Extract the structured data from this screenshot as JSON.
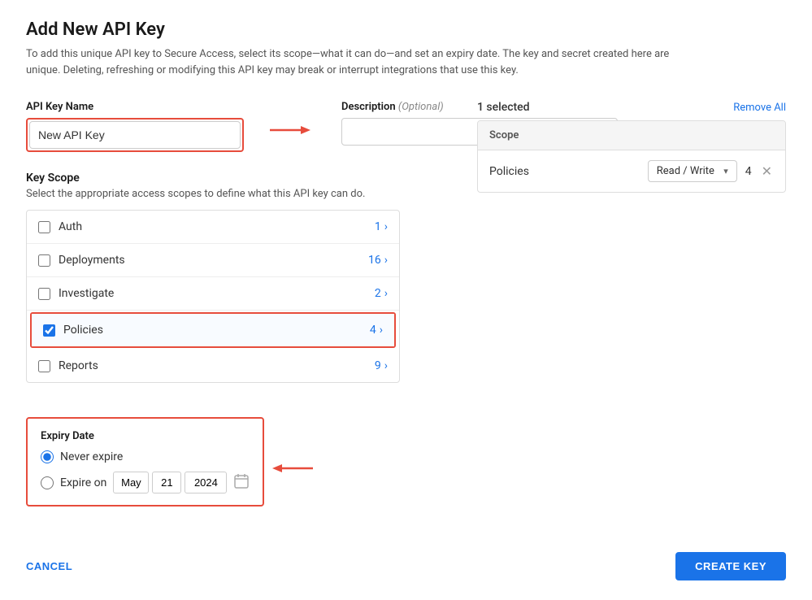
{
  "page": {
    "title": "Add New API Key",
    "description": "To add this unique API key to Secure Access, select its scope—what it can do—and set an expiry date. The key and secret created here are unique. Deleting, refreshing or modifying this API key may break or interrupt integrations that use this key."
  },
  "form": {
    "api_key_name_label": "API Key Name",
    "api_key_name_value": "New API Key",
    "description_label": "Description",
    "description_optional": "(Optional)",
    "description_placeholder": ""
  },
  "key_scope": {
    "title": "Key Scope",
    "description": "Select the appropriate access scopes to define what this API key can do.",
    "items": [
      {
        "name": "Auth",
        "count": "1",
        "checked": false
      },
      {
        "name": "Deployments",
        "count": "16",
        "checked": false
      },
      {
        "name": "Investigate",
        "count": "2",
        "checked": false
      },
      {
        "name": "Policies",
        "count": "4",
        "checked": true
      },
      {
        "name": "Reports",
        "count": "9",
        "checked": false
      }
    ]
  },
  "selected_scopes": {
    "count_label": "1 selected",
    "remove_all_label": "Remove All",
    "column_header": "Scope",
    "items": [
      {
        "name": "Policies",
        "permission": "Read / Write",
        "count": "4"
      }
    ]
  },
  "expiry": {
    "title": "Expiry Date",
    "options": [
      {
        "label": "Never expire",
        "value": "never",
        "selected": true
      },
      {
        "label": "Expire on",
        "value": "date",
        "selected": false
      }
    ],
    "date": {
      "month": "May",
      "day": "21",
      "year": "2024"
    }
  },
  "footer": {
    "cancel_label": "CANCEL",
    "create_label": "CREATE KEY"
  }
}
